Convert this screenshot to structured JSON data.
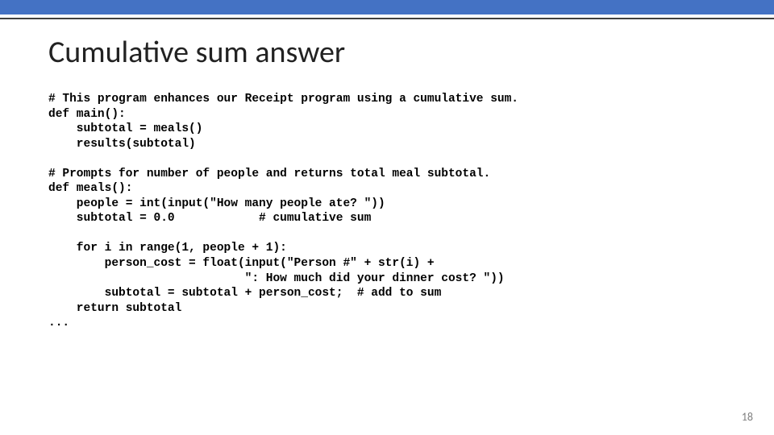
{
  "slide": {
    "title": "Cumulative sum answer",
    "page_number": "18"
  },
  "code": {
    "l01": "# This program enhances our Receipt program using a cumulative sum.",
    "l02": "def main():",
    "l03": "    subtotal = meals()",
    "l04": "    results(subtotal)",
    "l05": "",
    "l06": "# Prompts for number of people and returns total meal subtotal.",
    "l07": "def meals():",
    "l08": "    people = int(input(\"How many people ate? \"))",
    "l09": "    subtotal = 0.0            # cumulative sum",
    "l10": "",
    "l11": "    for i in range(1, people + 1):",
    "l12": "        person_cost = float(input(\"Person #\" + str(i) +",
    "l13": "                            \": How much did your dinner cost? \"))",
    "l14": "        subtotal = subtotal + person_cost;  # add to sum",
    "l15": "    return subtotal",
    "l16": "..."
  }
}
